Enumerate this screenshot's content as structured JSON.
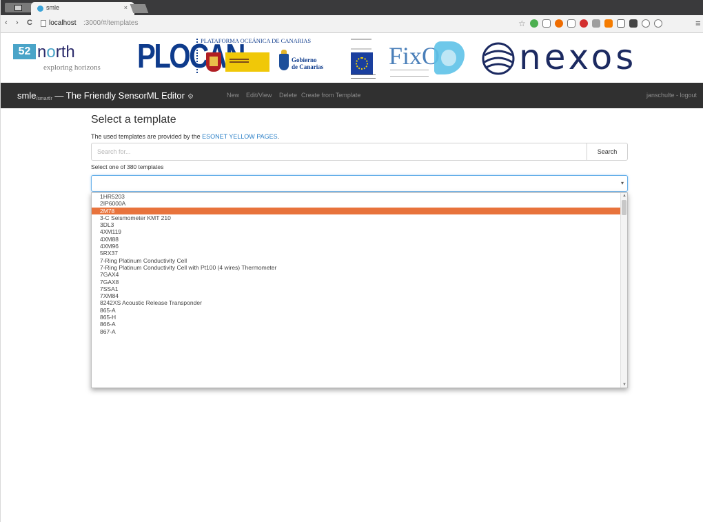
{
  "browser": {
    "tab_title": "smle",
    "tab_close": "×",
    "back": "‹",
    "forward": "›",
    "reload": "C",
    "url_host": "localhost",
    "url_path": ":3000/#/templates",
    "bookmark_star": "☆"
  },
  "banner": {
    "brand_52n_badge": "52",
    "brand_52n_word_n": "n",
    "brand_52n_word_o": "o",
    "brand_52n_word_rest": "rth",
    "brand_52n_tagline": "exploring horizons",
    "plocan": "PLOCAN",
    "plocan_tagline": "PLATAFORMA OCEÁNICA DE CANARIAS",
    "canarias_line1": "Gobierno",
    "canarias_line2": "de Canarias",
    "fixo": "FixO",
    "nexos": "nexos"
  },
  "navbar": {
    "brand": "smle",
    "brand_sub": "/smartlr",
    "brand_suffix": " — The Friendly SensorML Editor",
    "gear": "⚙",
    "links": [
      "New",
      "Edit/View",
      "Delete",
      "Create from Template"
    ],
    "user": "janschulte - logout"
  },
  "main": {
    "title": "Select a template",
    "intro_prefix": "The used templates are provided by the ",
    "intro_link": "ESONET YELLOW PAGES",
    "intro_suffix": ".",
    "search_placeholder": "Search for...",
    "search_button": "Search",
    "count_label": "Select one of 380 templates",
    "select_caret": "▾",
    "options": [
      "1HR5203",
      "2IP6000A",
      "2M78",
      "3-C Seismometer KMT 210",
      "3DL3",
      "4XM119",
      "4XM88",
      "4XM96",
      "5RX37",
      "7-Ring Platinum Conductivity Cell",
      "7-Ring Platinum Conductivity Cell with Pt100 (4 wires) Thermometer",
      "7GAX4",
      "7GAX8",
      "7SSA1",
      "7XM84",
      "8242XS Acoustic Release Transponder",
      "865-A",
      "865-H",
      "866-A",
      "867-A"
    ],
    "selected_index": 2,
    "scroll_up": "▲",
    "scroll_down": "▼"
  },
  "colors": {
    "navbar_bg": "#303030",
    "selected_option": "#e8733c",
    "link": "#2a7fc7",
    "focus_border": "#66afe9"
  }
}
